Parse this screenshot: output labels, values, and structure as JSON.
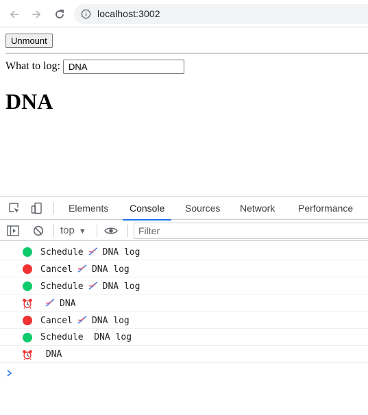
{
  "browser": {
    "url": "localhost:3002"
  },
  "page": {
    "unmount_label": "Unmount",
    "field_label": "What to log:",
    "field_value": "DNA",
    "heading": "DNA"
  },
  "devtools": {
    "tabs": [
      "Elements",
      "Console",
      "Sources",
      "Network",
      "Performance"
    ],
    "active_tab": "Console",
    "context": "top",
    "filter_placeholder": "Filter"
  },
  "console": {
    "messages": [
      {
        "icon": "green-circle",
        "before": "Schedule",
        "dna_glyph": true,
        "after": "DNA log"
      },
      {
        "icon": "red-circle",
        "before": "Cancel",
        "dna_glyph": true,
        "after": "DNA log"
      },
      {
        "icon": "green-circle",
        "before": "Schedule",
        "dna_glyph": true,
        "after": "DNA log"
      },
      {
        "icon": "alarm-clock",
        "before": "",
        "dna_glyph": true,
        "after": "DNA"
      },
      {
        "icon": "red-circle",
        "before": "Cancel",
        "dna_glyph": true,
        "after": "DNA log"
      },
      {
        "icon": "green-circle",
        "before": "Schedule",
        "dna_glyph": false,
        "after": "DNA log"
      },
      {
        "icon": "alarm-clock",
        "before": "",
        "dna_glyph": false,
        "after": "DNA"
      }
    ]
  },
  "colors": {
    "green": "#0ecb6b",
    "red": "#f03232",
    "accent": "#1a73e8"
  }
}
